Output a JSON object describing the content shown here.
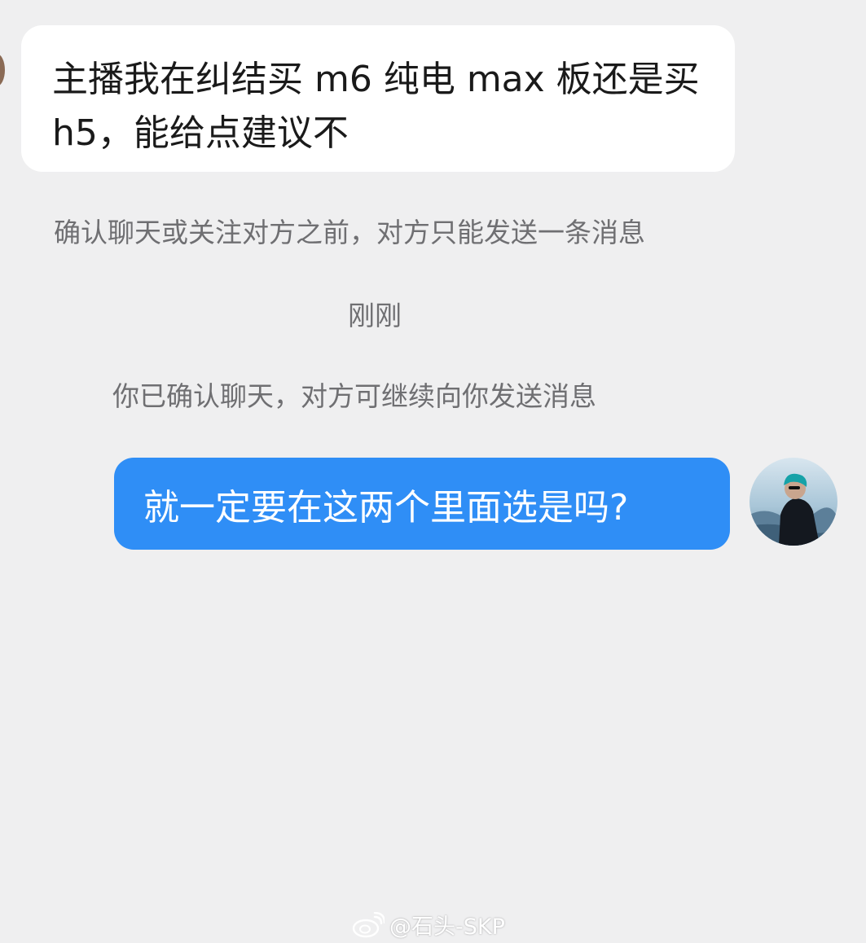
{
  "conversation": {
    "incoming_message": "主播我在纠结买 m6 纯电 max 板还是买 h5，能给点建议不",
    "notice_limit": "确认聊天或关注对方之前，对方只能发送一条消息",
    "timestamp": "刚刚",
    "notice_confirmed": "你已确认聊天，对方可继续向你发送消息",
    "outgoing_message": "就一定要在这两个里面选是吗?"
  },
  "watermark": {
    "text": "@石头-SKP",
    "icon": "weibo-icon"
  },
  "colors": {
    "background": "#efeff0",
    "incoming_bubble": "#ffffff",
    "outgoing_bubble": "#2f8ef6",
    "notice_text": "#6f6f72"
  }
}
